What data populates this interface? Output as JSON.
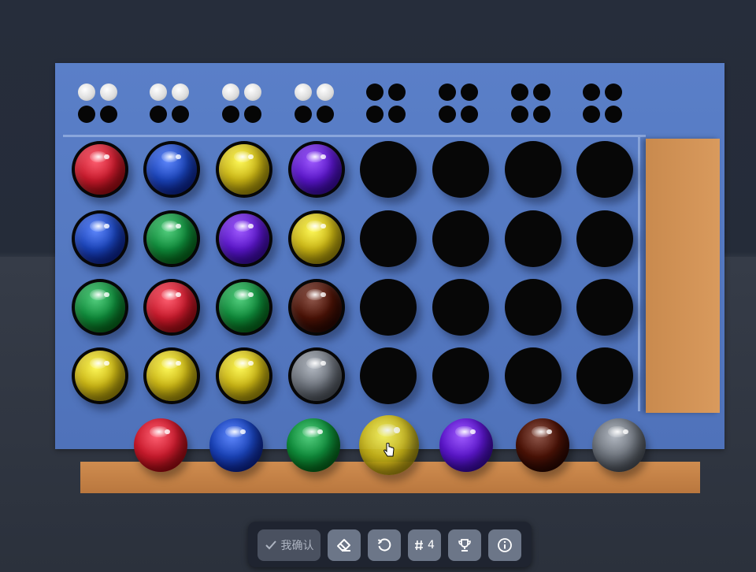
{
  "game": {
    "hint_rows": [
      [
        "white",
        "white",
        "empty",
        "empty"
      ],
      [
        "white",
        "white",
        "empty",
        "empty"
      ],
      [
        "white",
        "white",
        "empty",
        "empty"
      ],
      [
        "white",
        "white",
        "empty",
        "empty"
      ],
      [
        "empty",
        "empty",
        "empty",
        "empty"
      ],
      [
        "empty",
        "empty",
        "empty",
        "empty"
      ],
      [
        "empty",
        "empty",
        "empty",
        "empty"
      ],
      [
        "empty",
        "empty",
        "empty",
        "empty"
      ]
    ],
    "guess_rows": [
      [
        "red",
        "blue",
        "yellow",
        "purple",
        null,
        null,
        null,
        null
      ],
      [
        "blue",
        "green",
        "purple",
        "yellow",
        null,
        null,
        null,
        null
      ],
      [
        "green",
        "red",
        "green",
        "brown",
        null,
        null,
        null,
        null
      ],
      [
        "yellow",
        "yellow",
        "yellow",
        "gray",
        null,
        null,
        null,
        null
      ]
    ],
    "palette": [
      "red",
      "blue",
      "green",
      "yellow",
      "purple",
      "brown",
      "gray"
    ],
    "selected_palette_color": "yellow"
  },
  "colors": {
    "red": "#c81a2c",
    "blue": "#1a43b8",
    "green": "#0f8a3a",
    "yellow": "#c9b414",
    "purple": "#5a16c9",
    "brown": "#4a1206",
    "gray": "#6d737c",
    "board": "#5677c0",
    "tray": "#d4965a"
  },
  "toolbar": {
    "confirm_label": "我确认",
    "attempt_label": "4",
    "confirm_icon": "check-icon",
    "erase_icon": "eraser-icon",
    "restart_icon": "restart-icon",
    "attempt_icon": "hash-icon",
    "trophy_icon": "trophy-icon",
    "info_icon": "info-icon"
  }
}
